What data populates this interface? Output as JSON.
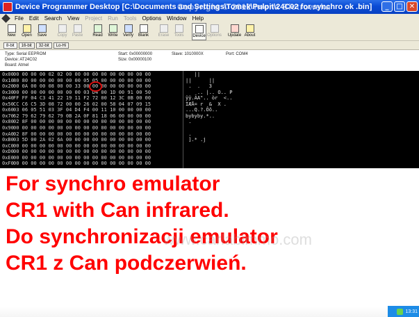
{
  "window": {
    "title": "Device Programmer Desktop   [C:\\Documents and Settings\\Tomek\\Pulpit\\24C02 for synchro ok .bin]",
    "watermark": "Copyright © 2012 Iwona Biotrowska"
  },
  "menu": [
    "File",
    "Edit",
    "Search",
    "View",
    "Project",
    "Run",
    "Tools",
    "Options",
    "Window",
    "Help"
  ],
  "menu_dim": [
    false,
    false,
    false,
    false,
    true,
    true,
    true,
    false,
    false,
    false
  ],
  "toolbar": [
    {
      "label": "New",
      "icon": "new-file-icon",
      "dim": false
    },
    {
      "label": "Open",
      "icon": "open-folder-icon",
      "dim": false
    },
    {
      "label": "Save",
      "icon": "save-disk-icon",
      "dim": false
    },
    {
      "label": "Copy",
      "icon": "copy-icon",
      "dim": true
    },
    {
      "label": "Paste",
      "icon": "paste-icon",
      "dim": true
    },
    {
      "label": "Read",
      "icon": "read-chip-icon",
      "dim": false
    },
    {
      "label": "Write",
      "icon": "write-chip-icon",
      "dim": false
    },
    {
      "label": "Verify",
      "icon": "verify-icon",
      "dim": false
    },
    {
      "label": "Blank",
      "icon": "blank-check-icon",
      "dim": false
    },
    {
      "label": "Erase",
      "icon": "erase-icon",
      "dim": true
    },
    {
      "label": "Tools",
      "icon": "tools-icon",
      "dim": true
    },
    {
      "label": "Device",
      "icon": "device-chip-icon",
      "dim": false
    },
    {
      "label": "Options",
      "icon": "options-icon",
      "dim": true
    },
    {
      "label": "Update",
      "icon": "update-icon",
      "dim": false
    },
    {
      "label": "About",
      "icon": "about-question-icon",
      "dim": false
    }
  ],
  "format_tabs": [
    "8-bit",
    "16-bit",
    "32-bit",
    "Lo-Hi"
  ],
  "info": {
    "type": "Type: Serial EEPROM",
    "device": "Device: AT24C02",
    "board": "Board: Atmel",
    "start": "Start: 0x00000000",
    "size": "Size: 0x00000100",
    "slave": "Slave: 1010000X",
    "port": "Port: COM4"
  },
  "hex_rows": [
    {
      "addr": "0x00",
      "bytes": "00 00 00 00 02 02 00 00 00 00 00 00 00 00 00 00",
      "ascii": "   ||"
    },
    {
      "addr": "0x10",
      "bytes": "80 80 00 00 00 00 00 00 05 05 00 00 00 00 00 00",
      "ascii": "||      ||"
    },
    {
      "addr": "0x20",
      "bytes": "00 0A 00 00 08 00 00 33 00 00 00 00 00 00 00 00",
      "ascii": " .  .   3"
    },
    {
      "addr": "0x30",
      "bytes": "00 00 00 00 00 00 00 00 03 D4 00 1D 00 91 00 50",
      "ascii": "    .. |.. O.. P"
    },
    {
      "addr": "0x40",
      "bytes": "FF FF 04 C3 41 22 19 11 F2 72 00 12 3C 0B 00 00",
      "ascii": "ÿÿ.ÃA\".. òr  <.."
    },
    {
      "addr": "0x50",
      "bytes": "CC C6 C5 3D 08 72 00 00 26 02 00 58 04 07 09 15",
      "ascii": "ÌÆÅ= r  &  X ."
    },
    {
      "addr": "0x60",
      "bytes": "03 06 05 51 03 3F 04 D4 F4 00 11 10 00 00 00 00",
      "ascii": "...Q.?.Ôô.."
    },
    {
      "addr": "0x70",
      "bytes": "62 79 62 79 62 79 0B 2A 0F 81 18 06 00 00 00 00",
      "ascii": "bybyby.*.."
    },
    {
      "addr": "0x80",
      "bytes": "02 8F 00 00 00 00 00 00 00 00 00 00 00 00 00 00",
      "ascii": " ."
    },
    {
      "addr": "0x90",
      "bytes": "00 00 00 00 00 00 00 00 00 00 00 00 00 00 00 00",
      "ascii": ""
    },
    {
      "addr": "0xA0",
      "bytes": "02 8F 00 00 00 00 00 00 00 00 00 00 00 00 00 00",
      "ascii": " ."
    },
    {
      "addr": "0xB0",
      "bytes": "03 5D 00 2A 02 6A 00 00 00 00 00 00 00 00 00 00",
      "ascii": " ].* .j"
    },
    {
      "addr": "0xC0",
      "bytes": "00 00 00 00 00 00 00 00 00 00 00 00 00 00 00 00",
      "ascii": ""
    },
    {
      "addr": "0xD0",
      "bytes": "00 00 00 00 00 00 00 00 00 00 00 00 00 00 00 00",
      "ascii": ""
    },
    {
      "addr": "0xE0",
      "bytes": "00 00 00 00 00 00 00 00 00 00 00 00 00 00 00 00",
      "ascii": ""
    },
    {
      "addr": "0xF0",
      "bytes": "00 00 00 00 00 00 00 00 00 00 00 00 00 00 00 00",
      "ascii": ""
    }
  ],
  "caption": [
    "For synchro emulator",
    "CR1 with Can infrared.",
    "Do synchronizacji emulator",
    "CR1 z Can podczerwień."
  ],
  "watermark_mid": "www.carlabimmo.com",
  "tray": {
    "clock": "13:31"
  },
  "colors": {
    "titlebar": "#0a4bd4",
    "caption_text": "#ff0000",
    "hex_background": "#000000",
    "highlight_ring": "#e01010"
  }
}
